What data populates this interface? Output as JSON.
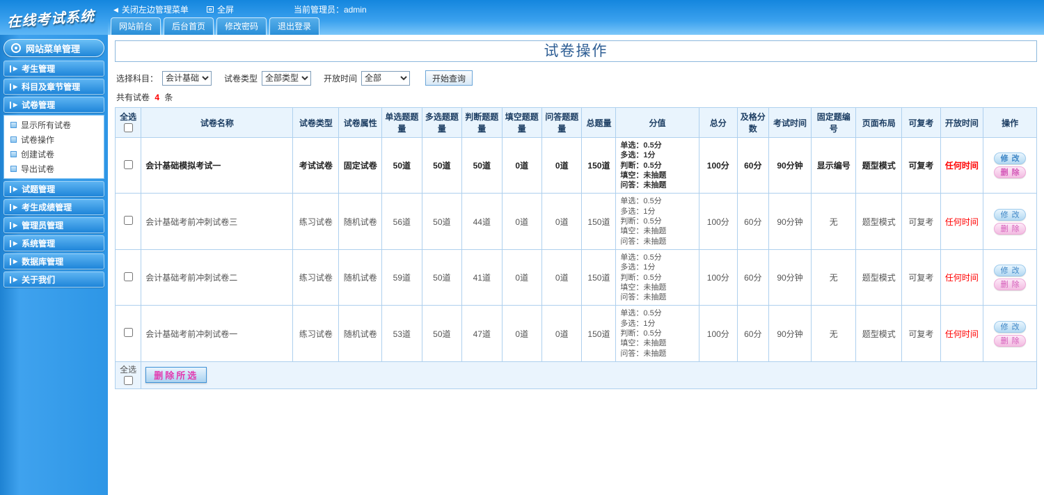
{
  "colors": {
    "accent": "#1e86d8",
    "alert_red": "#ff0000",
    "action_pink": "#e23bb0"
  },
  "topbar": {
    "close_menu": "关闭左边管理菜单",
    "fullscreen": "全屏",
    "admin_label": "当前管理员：admin",
    "tabs": [
      "网站前台",
      "后台首页",
      "修改密码",
      "退出登录"
    ]
  },
  "sidebar": {
    "logo": "在线考试系统",
    "title": "网站菜单管理",
    "items": [
      {
        "label": "考生管理"
      },
      {
        "label": "科目及章节管理"
      },
      {
        "label": "试卷管理",
        "children": [
          "显示所有试卷",
          "试卷操作",
          "创建试卷",
          "导出试卷"
        ]
      },
      {
        "label": "试题管理"
      },
      {
        "label": "考生成绩管理"
      },
      {
        "label": "管理员管理"
      },
      {
        "label": "系统管理"
      },
      {
        "label": "数据库管理"
      },
      {
        "label": "关于我们"
      }
    ]
  },
  "main": {
    "page_title": "试卷操作",
    "filters": {
      "subject_label": "选择科目：",
      "subject_value": "会计基础",
      "type_label": "试卷类型",
      "type_value": "全部类型",
      "time_label": "开放时间",
      "time_value": "全部",
      "search_button": "开始查询"
    },
    "summary": {
      "prefix": "共有试卷",
      "count": "4",
      "suffix": "条"
    },
    "table": {
      "headers": [
        "全选",
        "试卷名称",
        "试卷类型",
        "试卷属性",
        "单选题题量",
        "多选题题量",
        "判断题题量",
        "填空题题量",
        "问答题题量",
        "总题量",
        "分值",
        "总分",
        "及格分数",
        "考试时间",
        "固定题编号",
        "页面布局",
        "可复考",
        "开放时间",
        "操作"
      ],
      "edit_label": "修改",
      "delete_label": "删除",
      "rows": [
        {
          "name": "会计基础模拟考试一",
          "type": "考试试卷",
          "attribute": "固定试卷",
          "single": "50道",
          "multi": "50道",
          "judge": "50道",
          "fill": "0道",
          "qa": "0道",
          "total_questions": "150道",
          "scores": [
            "单选：0.5分",
            "多选：1分",
            "判断：0.5分",
            "填空：未抽题",
            "问答：未抽题"
          ],
          "total_score": "100分",
          "pass_score": "60分",
          "duration": "90分钟",
          "fixed_number": "显示编号",
          "layout": "题型模式",
          "retake": "可复考",
          "open_time": "任何时间",
          "bold": true
        },
        {
          "name": "会计基础考前冲刺试卷三",
          "type": "练习试卷",
          "attribute": "随机试卷",
          "single": "56道",
          "multi": "50道",
          "judge": "44道",
          "fill": "0道",
          "qa": "0道",
          "total_questions": "150道",
          "scores": [
            "单选：0.5分",
            "多选：1分",
            "判断：0.5分",
            "填空：未抽题",
            "问答：未抽题"
          ],
          "total_score": "100分",
          "pass_score": "60分",
          "duration": "90分钟",
          "fixed_number": "无",
          "layout": "题型模式",
          "retake": "可复考",
          "open_time": "任何时间",
          "bold": false
        },
        {
          "name": "会计基础考前冲刺试卷二",
          "type": "练习试卷",
          "attribute": "随机试卷",
          "single": "59道",
          "multi": "50道",
          "judge": "41道",
          "fill": "0道",
          "qa": "0道",
          "total_questions": "150道",
          "scores": [
            "单选：0.5分",
            "多选：1分",
            "判断：0.5分",
            "填空：未抽题",
            "问答：未抽题"
          ],
          "total_score": "100分",
          "pass_score": "60分",
          "duration": "90分钟",
          "fixed_number": "无",
          "layout": "题型模式",
          "retake": "可复考",
          "open_time": "任何时间",
          "bold": false
        },
        {
          "name": "会计基础考前冲刺试卷一",
          "type": "练习试卷",
          "attribute": "随机试卷",
          "single": "53道",
          "multi": "50道",
          "judge": "47道",
          "fill": "0道",
          "qa": "0道",
          "total_questions": "150道",
          "scores": [
            "单选：0.5分",
            "多选：1分",
            "判断：0.5分",
            "填空：未抽题",
            "问答：未抽题"
          ],
          "total_score": "100分",
          "pass_score": "60分",
          "duration": "90分钟",
          "fixed_number": "无",
          "layout": "题型模式",
          "retake": "可复考",
          "open_time": "任何时间",
          "bold": false
        }
      ]
    },
    "footer": {
      "select_all": "全选",
      "delete_button": "删除所选"
    }
  }
}
